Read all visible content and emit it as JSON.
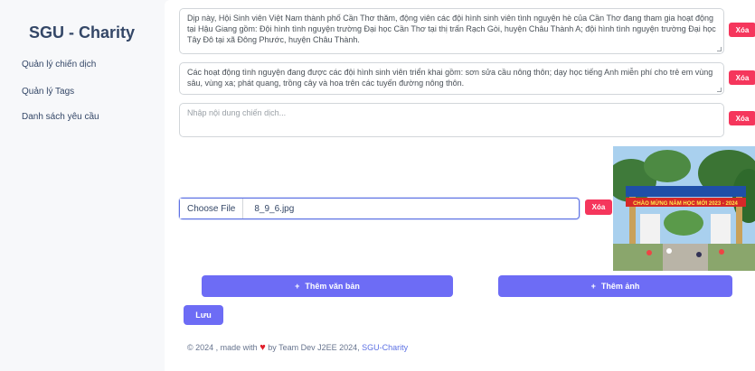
{
  "sidebar": {
    "brand": "SGU - Charity",
    "items": [
      {
        "label": "Quản lý chiến dịch"
      },
      {
        "label": "Quản lý Tags"
      },
      {
        "label": "Danh sách yêu cầu"
      }
    ]
  },
  "editor": {
    "blocks": [
      {
        "text": "Dịp này, Hội Sinh viên Việt Nam thành phố Cần Thơ thăm, động viên các đội hình sinh viên tình nguyện hè của Cần Thơ đang tham gia hoạt động tại Hậu Giang gồm: Đội hình tình nguyện trường Đại học Cần Thơ tại thị trấn Rạch Gòi, huyện Châu Thành A; đội hình tình nguyện trường Đại học Tây Đô tại xã Đông Phước, huyện Châu Thành.",
        "delete_label": "Xóa"
      },
      {
        "text": "Các hoạt động tình nguyện đang được các đội hình sinh viên triển khai gồm: sơn sửa cầu nông thôn; dạy học tiếng Anh miễn phí cho trẻ em vùng sâu, vùng xa; phát quang, trồng cây và hoa trên các tuyến đường nông thôn.",
        "delete_label": "Xóa"
      },
      {
        "text": "",
        "placeholder": "Nhập nội dung chiến dịch...",
        "delete_label": "Xóa"
      }
    ],
    "file": {
      "choose_label": "Choose File",
      "file_name": "8_9_6.jpg",
      "delete_label": "Xóa"
    },
    "image_banner": "CHÀO MỪNG NĂM HỌC MỚI 2023 - 2024"
  },
  "actions": {
    "add_text_label": "Thêm văn bản",
    "add_image_label": "Thêm ảnh",
    "save_label": "Lưu"
  },
  "footer": {
    "prefix": "© 2024 , made with",
    "suffix": "by Team Dev J2EE 2024,",
    "link": "SGU-Charity"
  },
  "colors": {
    "primary": "#6d6cf5",
    "danger": "#f5365c",
    "link": "#5e72e4"
  }
}
